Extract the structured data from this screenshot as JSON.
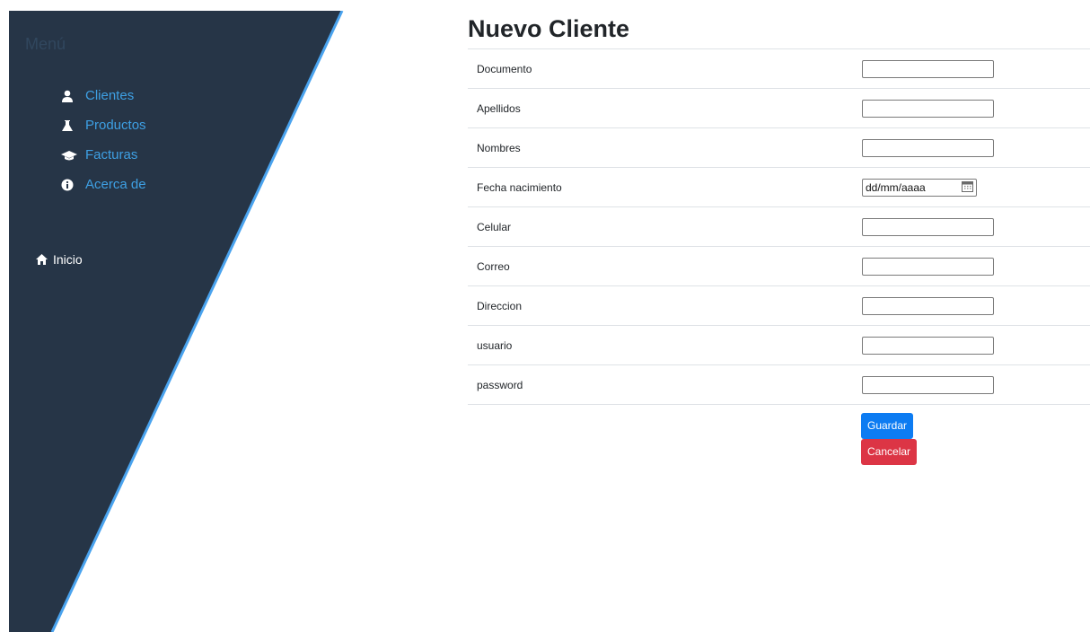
{
  "sidebar": {
    "title": "Menú",
    "items": [
      {
        "label": "Clientes",
        "icon": "user-icon"
      },
      {
        "label": "Productos",
        "icon": "flask-icon"
      },
      {
        "label": "Facturas",
        "icon": "graduation-cap-icon"
      },
      {
        "label": "Acerca de",
        "icon": "info-circle-icon"
      }
    ],
    "home": {
      "label": "Inicio",
      "icon": "home-icon"
    },
    "colors": {
      "background": "#263547",
      "link": "#3ea0e4",
      "edge": "#4aa3ee"
    }
  },
  "main": {
    "title": "Nuevo Cliente",
    "fields": [
      {
        "label": "Documento",
        "value": ""
      },
      {
        "label": "Apellidos",
        "value": ""
      },
      {
        "label": "Nombres",
        "value": ""
      },
      {
        "label": "Fecha nacimiento",
        "value": "dd/mm/aaaa",
        "type": "date"
      },
      {
        "label": "Celular",
        "value": ""
      },
      {
        "label": "Correo",
        "value": ""
      },
      {
        "label": "Direccion",
        "value": ""
      },
      {
        "label": "usuario",
        "value": ""
      },
      {
        "label": "password",
        "value": ""
      }
    ],
    "buttons": {
      "save": "Guardar",
      "cancel": "Cancelar"
    },
    "colors": {
      "primary": "#0d7cf2",
      "danger": "#dc3545"
    }
  }
}
